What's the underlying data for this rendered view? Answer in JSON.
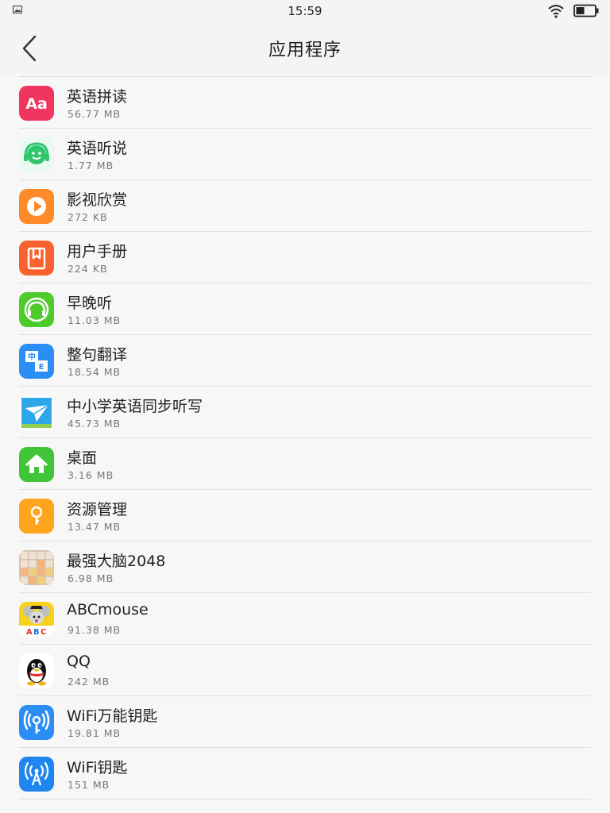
{
  "status_bar": {
    "time": "15:59"
  },
  "header": {
    "title": "应用程序"
  },
  "apps": [
    {
      "name": "英语拼读",
      "size": "56.77 MB",
      "icon": "aa-letters-icon",
      "color": "#f0355f"
    },
    {
      "name": "英语听说",
      "size": "1.77 MB",
      "icon": "headset-face-icon",
      "color": "#2fc56d"
    },
    {
      "name": "影视欣赏",
      "size": "272 KB",
      "icon": "play-icon",
      "color": "#ff8a2a"
    },
    {
      "name": "用户手册",
      "size": "224 KB",
      "icon": "bookmark-book-icon",
      "color": "#f9622f"
    },
    {
      "name": "早晚听",
      "size": "11.03 MB",
      "icon": "headphones-icon",
      "color": "#4ccb2b"
    },
    {
      "name": "整句翻译",
      "size": "18.54 MB",
      "icon": "translate-icon",
      "color": "#2a8ef5"
    },
    {
      "name": "中小学英语同步听写",
      "size": "45.73 MB",
      "icon": "paper-plane-icon",
      "color": "#2da7ea"
    },
    {
      "name": "桌面",
      "size": "3.16 MB",
      "icon": "home-icon",
      "color": "#3fc537"
    },
    {
      "name": "资源管理",
      "size": "13.47 MB",
      "icon": "location-pin-icon",
      "color": "#ffa51d"
    },
    {
      "name": "最强大脑2048",
      "size": "6.98 MB",
      "icon": "grid-2048-icon",
      "color": "#e9c39d"
    },
    {
      "name": "ABCmouse",
      "size": "91.38 MB",
      "icon": "abcmouse-mascot-icon",
      "color": "#f8d21a"
    },
    {
      "name": "QQ",
      "size": "242 MB",
      "icon": "qq-penguin-icon",
      "color": "#ffffff"
    },
    {
      "name": "WiFi万能钥匙",
      "size": "19.81 MB",
      "icon": "wifi-key-icon",
      "color": "#2a8ef5"
    },
    {
      "name": "WiFi钥匙",
      "size": "151 MB",
      "icon": "wifi-antenna-icon",
      "color": "#1f86f0"
    }
  ]
}
